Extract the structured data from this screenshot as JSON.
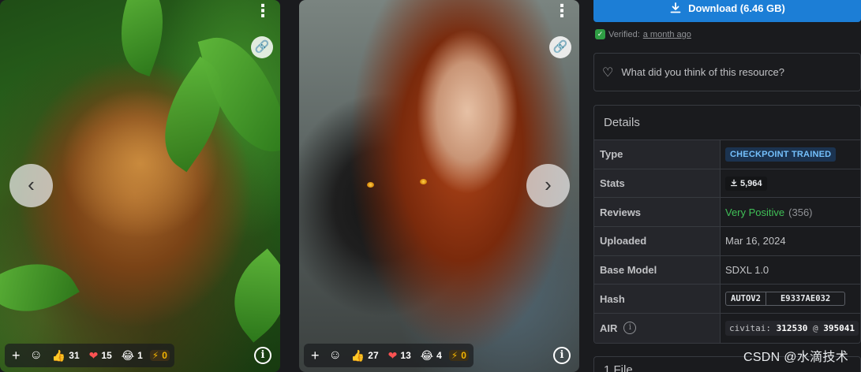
{
  "cards": [
    {
      "reactions": {
        "thumbs": "31",
        "hearts": "15",
        "laugh": "1",
        "buzz": "0"
      }
    },
    {
      "reactions": {
        "thumbs": "27",
        "hearts": "13",
        "laugh": "4",
        "buzz": "0"
      }
    }
  ],
  "icons": {
    "plus": "+",
    "smiley": "☺",
    "thumbs": "👍",
    "heart": "❤",
    "laugh": "😂",
    "bolt": "⚡",
    "info": "i",
    "prev": "‹",
    "next": "›",
    "dots": "⋮",
    "link": "🔗"
  },
  "download": {
    "label": "Download (6.46 GB)"
  },
  "verified": {
    "prefix": "Verified:",
    "when": "a month ago"
  },
  "feedback": {
    "prompt": "What did you think of this resource?"
  },
  "details": {
    "title": "Details",
    "type_label": "Type",
    "type_value": "CHECKPOINT TRAINED",
    "stats_label": "Stats",
    "stats_value": "5,964",
    "reviews_label": "Reviews",
    "reviews_value": "Very Positive",
    "reviews_count": "(356)",
    "uploaded_label": "Uploaded",
    "uploaded_value": "Mar 16, 2024",
    "base_label": "Base Model",
    "base_value": "SDXL 1.0",
    "hash_label": "Hash",
    "hash_algo": "AUTOV2",
    "hash_value": "E9337AE032",
    "air_label": "AIR",
    "air_prefix": "civitai:",
    "air_model": "312530",
    "air_at": "@",
    "air_version": "395041"
  },
  "files": {
    "title": "1 File"
  },
  "watermark": "CSDN @水滴技术",
  "colors": {
    "accent": "#1c7ed6",
    "positive": "#40c057",
    "background": "#1a1b1e"
  }
}
